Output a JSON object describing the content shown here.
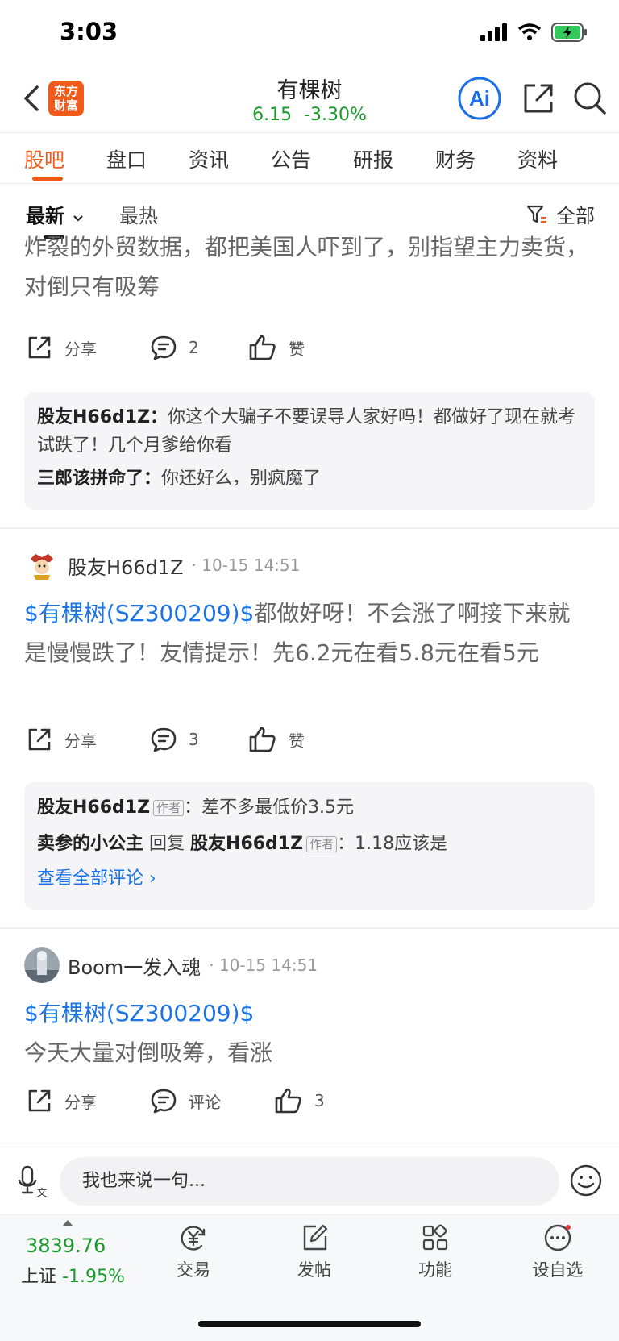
{
  "status": {
    "time": "3:03"
  },
  "nav": {
    "logo_line1": "东方",
    "logo_line2": "财富",
    "title": "有棵树",
    "price": "6.15",
    "change": "-3.30%"
  },
  "tabs": [
    "股吧",
    "盘口",
    "资讯",
    "公告",
    "研报",
    "财务",
    "资料"
  ],
  "sort": {
    "latest": "最新",
    "hot": "最热",
    "filter": "全部"
  },
  "post1": {
    "text": "炸裂的外贸数据，都把美国人吓到了，别指望主力卖货，对倒只有吸筹",
    "share": "分享",
    "comments": "2",
    "like": "赞",
    "replies": [
      {
        "user": "股友H66d1Z：",
        "text": "你这个大骗子不要误导人家好吗！都做好了现在就考试跌了！几个月爹给你看"
      },
      {
        "user": "三郎该拼命了：",
        "text": "你还好么，别疯魔了"
      }
    ]
  },
  "post2": {
    "author": "股友H66d1Z",
    "time": "10-15 14:51",
    "stock_link": "$有棵树(SZ300209)$",
    "text": "都做好呀！不会涨了啊接下来就是慢慢跌了！友情提示！先6.2元在看5.8元在看5元",
    "share": "分享",
    "comments": "3",
    "like": "赞",
    "replies": {
      "r1_user": "股友H66d1Z",
      "r1_tag": "作者",
      "r1_text": "：差不多最低价3.5元",
      "r2_user": "卖参的小公主",
      "r2_reply": "回复",
      "r2_target": "股友H66d1Z",
      "r2_tag": "作者",
      "r2_text": "：1.18应该是",
      "view_all": "查看全部评论 ›"
    }
  },
  "post3": {
    "author": "Boom一发入魂",
    "time": "10-15 14:51",
    "stock_link": "$有棵树(SZ300209)$",
    "text": "今天大量对倒吸筹，看涨",
    "share": "分享",
    "comments": "评论",
    "likes": "3"
  },
  "input": {
    "placeholder": "我也来说一句..."
  },
  "bottom": {
    "index_value": "3839.76",
    "index_name": "上证",
    "index_change": "-1.95%",
    "trade": "交易",
    "post": "发帖",
    "function": "功能",
    "watchlist": "设自选"
  },
  "colors": {
    "accent": "#f05a1a",
    "down": "#1b9a2c",
    "link": "#1a73e8"
  }
}
